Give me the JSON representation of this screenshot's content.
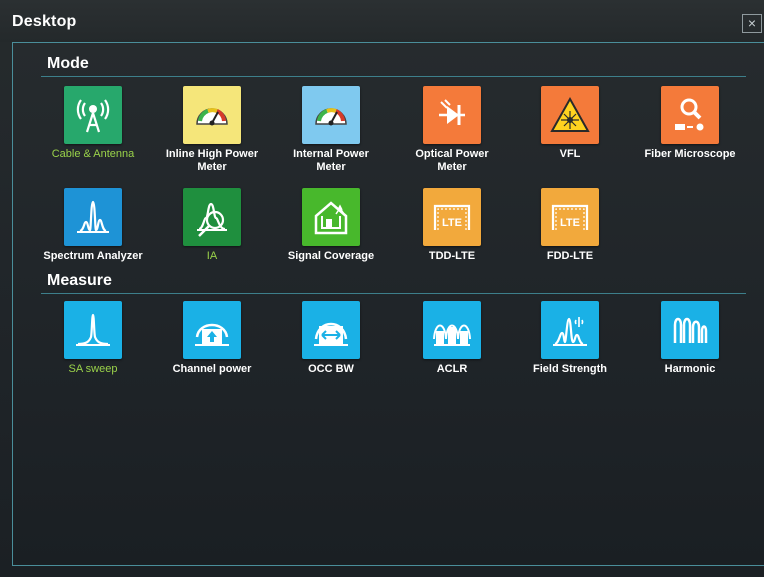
{
  "window": {
    "title": "Desktop",
    "close_glyph": "×"
  },
  "sections": {
    "mode": {
      "label": "Mode"
    },
    "measure": {
      "label": "Measure"
    }
  },
  "mode_items": [
    {
      "label": "Cable & Antenna",
      "icon": "antenna-icon",
      "color": "#27a86c",
      "active": true
    },
    {
      "label": "Inline High Power\nMeter",
      "icon": "power-meter-icon",
      "color": "#f5e67a",
      "active": false
    },
    {
      "label": "Internal Power\nMeter",
      "icon": "power-meter-icon",
      "color": "#7fc9ef",
      "active": false
    },
    {
      "label": "Optical Power\nMeter",
      "icon": "optical-power-icon",
      "color": "#f47a3a",
      "active": false
    },
    {
      "label": "VFL",
      "icon": "laser-warning-icon",
      "color": "#f47a3a",
      "active": false
    },
    {
      "label": "Fiber Microscope",
      "icon": "microscope-icon",
      "color": "#f47a3a",
      "active": false
    },
    {
      "label": "Spectrum Analyzer",
      "icon": "spectrum-icon",
      "color": "#1e93d6",
      "active": false
    },
    {
      "label": "IA",
      "icon": "interference-icon",
      "color": "#1f8f3e",
      "active": true
    },
    {
      "label": "Signal Coverage",
      "icon": "coverage-icon",
      "color": "#48b82c",
      "active": false
    },
    {
      "label": "TDD-LTE",
      "icon": "lte-icon",
      "color": "#f2a93c",
      "active": false
    },
    {
      "label": "FDD-LTE",
      "icon": "lte-icon",
      "color": "#f2a93c",
      "active": false
    }
  ],
  "measure_items": [
    {
      "label": "SA sweep",
      "icon": "sweep-icon",
      "color": "#1ab1e6",
      "active": true
    },
    {
      "label": "Channel power",
      "icon": "channel-power-icon",
      "color": "#1ab1e6",
      "active": false
    },
    {
      "label": "OCC BW",
      "icon": "occ-bw-icon",
      "color": "#1ab1e6",
      "active": false
    },
    {
      "label": "ACLR",
      "icon": "aclr-icon",
      "color": "#1ab1e6",
      "active": false
    },
    {
      "label": "Field Strength",
      "icon": "field-strength-icon",
      "color": "#1ab1e6",
      "active": false
    },
    {
      "label": "Harmonic",
      "icon": "harmonic-icon",
      "color": "#1ab1e6",
      "active": false
    }
  ],
  "lte_badge": "LTE"
}
